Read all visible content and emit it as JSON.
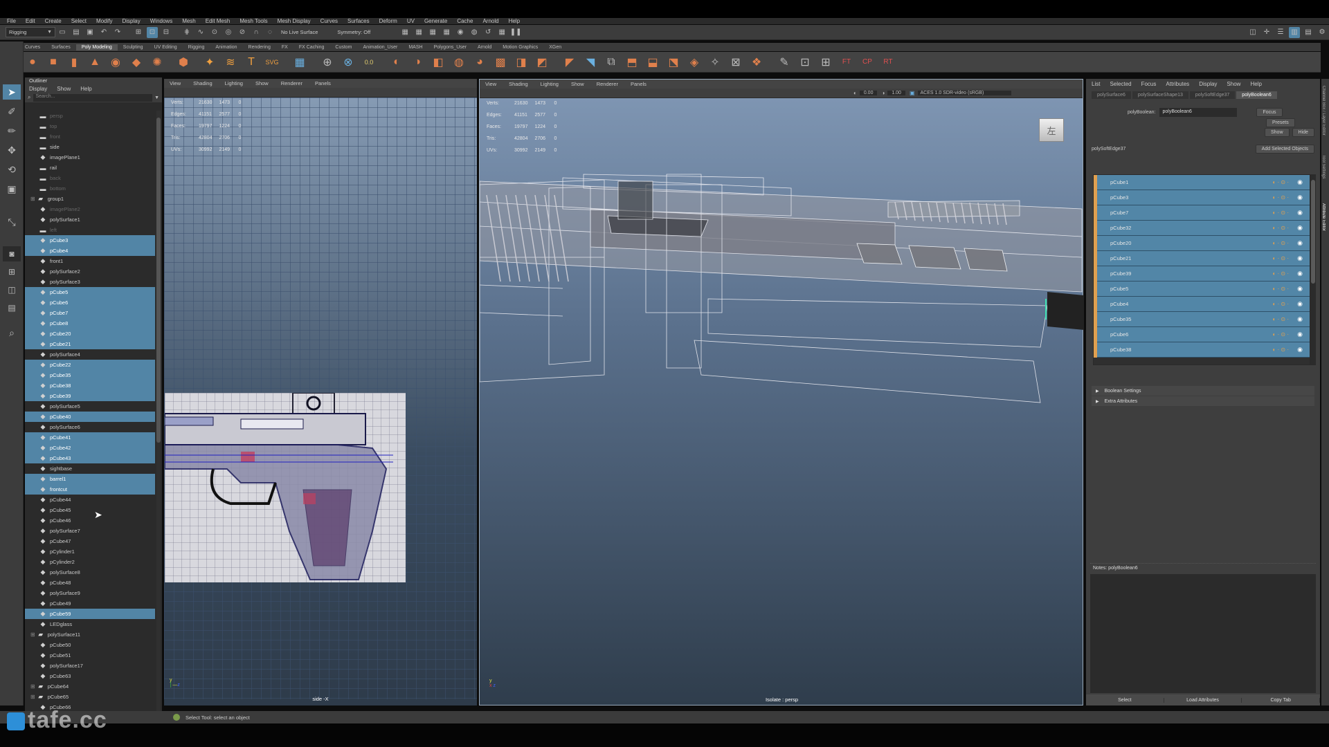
{
  "menubar": {
    "items": [
      "File",
      "Edit",
      "Create",
      "Select",
      "Modify",
      "Display",
      "Windows",
      "Mesh",
      "Edit Mesh",
      "Mesh Tools",
      "Mesh Display",
      "Curves",
      "Surfaces",
      "Deform",
      "UV",
      "Generate",
      "Cache",
      "Arnold",
      "Help"
    ]
  },
  "statusline": {
    "mode": "Rigging",
    "live_surface": "No Live Surface",
    "symmetry": "Symmetry: Off"
  },
  "shelf": {
    "tabs": [
      "Curves",
      "Surfaces",
      "Poly Modeling",
      "Sculpting",
      "UV Editing",
      "Rigging",
      "Animation",
      "Rendering",
      "FX",
      "FX Caching",
      "Custom",
      "Animation_User",
      "MASH",
      "Polygons_User",
      "Arnold",
      "Motion Graphics",
      "XGen"
    ],
    "active": "Poly Modeling"
  },
  "outliner": {
    "title": "Outliner",
    "menu": [
      "Display",
      "Show",
      "Help"
    ],
    "search_placeholder": "Search...",
    "items": [
      {
        "label": "persp",
        "icon": "camera",
        "sel": false,
        "dim": true
      },
      {
        "label": "top",
        "icon": "camera",
        "sel": false,
        "dim": true
      },
      {
        "label": "front",
        "icon": "camera",
        "sel": false,
        "dim": true
      },
      {
        "label": "side",
        "icon": "camera",
        "sel": false,
        "dim": false
      },
      {
        "label": "imagePlane1",
        "icon": "mesh",
        "sel": false,
        "dim": false
      },
      {
        "label": "rail",
        "icon": "camera",
        "sel": false,
        "dim": false
      },
      {
        "label": "back",
        "icon": "camera",
        "sel": false,
        "dim": true
      },
      {
        "label": "bottom",
        "icon": "camera",
        "sel": false,
        "dim": true
      },
      {
        "label": "group1",
        "icon": "group",
        "sel": false,
        "dim": false
      },
      {
        "label": "imagePlane2",
        "icon": "mesh",
        "sel": false,
        "dim": true
      },
      {
        "label": "polySurface1",
        "icon": "mesh",
        "sel": false,
        "dim": false
      },
      {
        "label": "left",
        "icon": "camera",
        "sel": false,
        "dim": true
      },
      {
        "label": "pCube3",
        "icon": "mesh",
        "sel": true,
        "dim": false
      },
      {
        "label": "pCube4",
        "icon": "mesh",
        "sel": true,
        "dim": false
      },
      {
        "label": "front1",
        "icon": "mesh",
        "sel": false,
        "dim": false
      },
      {
        "label": "polySurface2",
        "icon": "mesh",
        "sel": false,
        "dim": false
      },
      {
        "label": "polySurface3",
        "icon": "mesh",
        "sel": false,
        "dim": false
      },
      {
        "label": "pCube5",
        "icon": "mesh",
        "sel": true,
        "dim": false
      },
      {
        "label": "pCube6",
        "icon": "mesh",
        "sel": true,
        "dim": false
      },
      {
        "label": "pCube7",
        "icon": "mesh",
        "sel": true,
        "dim": false
      },
      {
        "label": "pCube8",
        "icon": "mesh",
        "sel": true,
        "dim": false
      },
      {
        "label": "pCube20",
        "icon": "mesh",
        "sel": true,
        "dim": false
      },
      {
        "label": "pCube21",
        "icon": "mesh",
        "sel": true,
        "dim": false
      },
      {
        "label": "polySurface4",
        "icon": "mesh",
        "sel": false,
        "dim": false
      },
      {
        "label": "pCube22",
        "icon": "mesh",
        "sel": true,
        "dim": false
      },
      {
        "label": "pCube35",
        "icon": "mesh",
        "sel": true,
        "dim": false
      },
      {
        "label": "pCube38",
        "icon": "mesh",
        "sel": true,
        "dim": false
      },
      {
        "label": "pCube39",
        "icon": "mesh",
        "sel": true,
        "dim": false
      },
      {
        "label": "polySurface5",
        "icon": "mesh",
        "sel": false,
        "dim": false
      },
      {
        "label": "pCube40",
        "icon": "mesh",
        "sel": true,
        "dim": false
      },
      {
        "label": "polySurface6",
        "icon": "mesh",
        "sel": false,
        "dim": false
      },
      {
        "label": "pCube41",
        "icon": "mesh",
        "sel": true,
        "dim": false
      },
      {
        "label": "pCube42",
        "icon": "mesh",
        "sel": true,
        "dim": false
      },
      {
        "label": "pCube43",
        "icon": "mesh",
        "sel": true,
        "dim": false
      },
      {
        "label": "sightbase",
        "icon": "mesh",
        "sel": false,
        "dim": false
      },
      {
        "label": "barrel1",
        "icon": "mesh",
        "sel": true,
        "dim": false
      },
      {
        "label": "frontcut",
        "icon": "mesh",
        "sel": true,
        "dim": false
      },
      {
        "label": "pCube44",
        "icon": "mesh",
        "sel": false,
        "dim": false
      },
      {
        "label": "pCube45",
        "icon": "mesh",
        "sel": false,
        "dim": false
      },
      {
        "label": "pCube46",
        "icon": "mesh",
        "sel": false,
        "dim": false
      },
      {
        "label": "polySurface7",
        "icon": "mesh",
        "sel": false,
        "dim": false
      },
      {
        "label": "pCube47",
        "icon": "mesh",
        "sel": false,
        "dim": false
      },
      {
        "label": "pCylinder1",
        "icon": "mesh",
        "sel": false,
        "dim": false
      },
      {
        "label": "pCylinder2",
        "icon": "mesh",
        "sel": false,
        "dim": false
      },
      {
        "label": "polySurface8",
        "icon": "mesh",
        "sel": false,
        "dim": false
      },
      {
        "label": "pCube48",
        "icon": "mesh",
        "sel": false,
        "dim": false
      },
      {
        "label": "polySurface9",
        "icon": "mesh",
        "sel": false,
        "dim": false
      },
      {
        "label": "pCube49",
        "icon": "mesh",
        "sel": false,
        "dim": false
      },
      {
        "label": "pCube59",
        "icon": "mesh",
        "sel": true,
        "dim": false
      },
      {
        "label": "LEDglass",
        "icon": "mesh",
        "sel": false,
        "dim": false
      },
      {
        "label": "polySurface11",
        "icon": "group",
        "sel": false,
        "dim": false
      },
      {
        "label": "pCube50",
        "icon": "mesh",
        "sel": false,
        "dim": false
      },
      {
        "label": "pCube51",
        "icon": "mesh",
        "sel": false,
        "dim": false
      },
      {
        "label": "polySurface17",
        "icon": "mesh",
        "sel": false,
        "dim": false
      },
      {
        "label": "pCube63",
        "icon": "mesh",
        "sel": false,
        "dim": false
      },
      {
        "label": "pCube64",
        "icon": "group",
        "sel": false,
        "dim": false
      },
      {
        "label": "pCube65",
        "icon": "group",
        "sel": false,
        "dim": false
      },
      {
        "label": "pCube66",
        "icon": "mesh",
        "sel": false,
        "dim": false
      }
    ]
  },
  "viewport_left": {
    "menu": [
      "View",
      "Shading",
      "Lighting",
      "Show",
      "Renderer",
      "Panels"
    ],
    "hud": [
      [
        "Verts:",
        "21630",
        "1473",
        "0"
      ],
      [
        "Edges:",
        "41151",
        "2577",
        "0"
      ],
      [
        "Faces:",
        "19797",
        "1224",
        "0"
      ],
      [
        "Tris:",
        "42804",
        "2706",
        "0"
      ],
      [
        "UVs:",
        "30992",
        "2149",
        "0"
      ]
    ],
    "label": "side -X"
  },
  "viewport_right": {
    "menu": [
      "View",
      "Shading",
      "Lighting",
      "Show",
      "Renderer",
      "Panels"
    ],
    "hud": [
      [
        "Verts:",
        "21630",
        "1473",
        "0"
      ],
      [
        "Edges:",
        "41151",
        "2577",
        "0"
      ],
      [
        "Faces:",
        "19797",
        "1224",
        "0"
      ],
      [
        "Tris:",
        "42804",
        "2706",
        "0"
      ],
      [
        "UVs:",
        "30992",
        "2149",
        "0"
      ]
    ],
    "label": "Isolate : persp",
    "exposure": "0.00",
    "gamma": "1.00",
    "colorspace": "ACES 1.0 SDR-video (sRGB)",
    "viewcube": "左"
  },
  "attribute_editor": {
    "menu": [
      "List",
      "Selected",
      "Focus",
      "Attributes",
      "Display",
      "Show",
      "Help"
    ],
    "tabs": [
      "polySurface6",
      "polySurfaceShape13",
      "polySoftEdge37",
      "polyBoolean6"
    ],
    "active_tab": "polyBoolean6",
    "field_label": "polyBoolean:",
    "field_value": "polyBoolean6",
    "focus": "Focus",
    "presets": "Presets",
    "show": "Show",
    "hide": "Hide",
    "node_label": "polySoftEdge37",
    "add_selected": "Add Selected Objects",
    "inputs": [
      "pCube1",
      "pCube3",
      "pCube7",
      "pCube32",
      "pCube20",
      "pCube21",
      "pCube39",
      "pCube5",
      "pCube4",
      "pCube35",
      "pCube6",
      "pCube38"
    ],
    "sections": [
      "Boolean Settings",
      "Extra Attributes"
    ],
    "notes": "Notes: polyBoolean6",
    "buttons": [
      "Select",
      "Load Attributes",
      "Copy Tab"
    ],
    "side_tabs": [
      "Channel Box / Layer Editor",
      "Tool Settings",
      "Attribute Editor"
    ]
  },
  "helpline": {
    "text": "Select Tool: select an object"
  },
  "watermark": "tafe.cc",
  "colors": {
    "selection": "#5285a6",
    "viewport_top": "#8198b5",
    "viewport_bottom": "#2f3d4c",
    "accent_orange": "#e0804c"
  }
}
